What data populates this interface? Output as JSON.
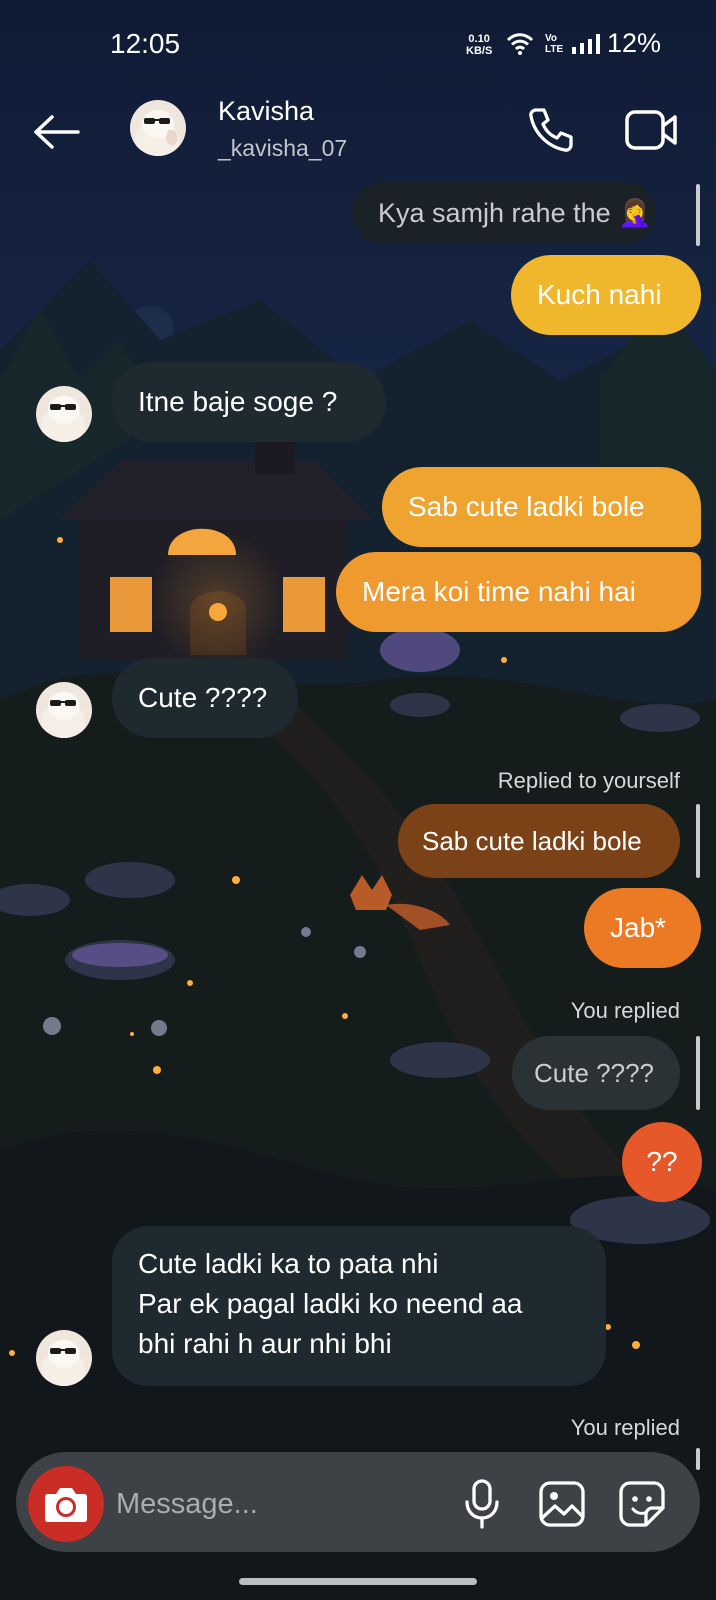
{
  "status_bar": {
    "time": "12:05",
    "net_speed_value": "0.10",
    "net_speed_unit": "KB/S",
    "volte_top": "Vo",
    "volte_bottom": "LTE",
    "battery": "12%"
  },
  "header": {
    "name": "Kavisha",
    "username": "_kavisha_07",
    "icons": [
      "arrow-left-icon",
      "phone-icon",
      "video-camera-icon"
    ]
  },
  "messages": [
    {
      "side": "in-reply",
      "text": "Kya samjh rahe the 🤦‍♀️"
    },
    {
      "side": "out",
      "text": "Kuch nahi",
      "color": "#f0b72c"
    },
    {
      "side": "in",
      "text": "Itne baje soge ?"
    },
    {
      "side": "out",
      "text": "Sab cute ladki bole",
      "color": "#f0a430"
    },
    {
      "side": "out",
      "text": "Mera koi time nahi hai",
      "color": "#ee9a2e"
    },
    {
      "side": "in",
      "text": "Cute ????"
    },
    {
      "side": "meta",
      "text": "Replied to yourself"
    },
    {
      "side": "quoted",
      "text": "Sab cute ladki bole",
      "color": "#7b4217"
    },
    {
      "side": "out",
      "text": "Jab*",
      "color": "#ec7a24"
    },
    {
      "side": "meta",
      "text": "You replied"
    },
    {
      "side": "quoted",
      "text": "Cute ????",
      "color": "#2b3235"
    },
    {
      "side": "out",
      "text": "??",
      "color": "#e6582a"
    },
    {
      "side": "in",
      "lines": [
        "Cute ladki ka to pata nhi",
        "Par ek pagal ladki ko neend aa",
        "bhi rahi h aur nhi bhi"
      ]
    },
    {
      "side": "meta",
      "text": "You replied"
    }
  ],
  "composer": {
    "placeholder": "Message...",
    "icons": [
      "camera-icon",
      "microphone-icon",
      "gallery-icon",
      "sticker-icon"
    ]
  },
  "colors": {
    "incoming_bubble": "#1f2a30",
    "camera_button": "#c92d26",
    "composer_bg": "#3e4246"
  }
}
